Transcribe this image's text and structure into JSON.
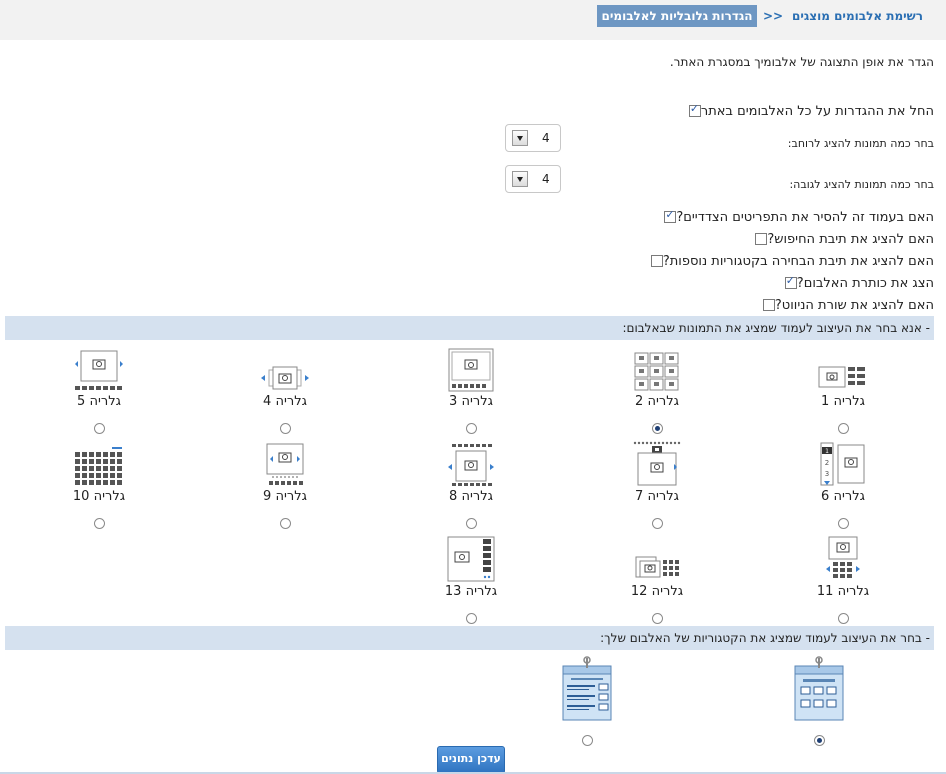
{
  "breadcrumb": {
    "active": "הגדרות גלובליות לאלבומים",
    "separator": ">>",
    "link": "רשימת אלבומים מוצגים"
  },
  "intro": "הגדר את אופן התצוגה של אלבומיך במסגרת האתר.",
  "apply_all": {
    "label": "החל את ההגדרות על כל האלבומים באתר",
    "checked": true
  },
  "width_select": {
    "label": "בחר כמה תמונות להציג לרוחב:",
    "value": "4"
  },
  "height_select": {
    "label": "בחר כמה תמונות להציג לגובה:",
    "value": "4"
  },
  "options": [
    {
      "label": "האם בעמוד זה להסיר את התפריטים הצדדיים?",
      "checked": true
    },
    {
      "label": "האם להציג את תיבת החיפוש?",
      "checked": false
    },
    {
      "label": "האם להציג את תיבת הבחירה בקטגוריות נוספות?",
      "checked": false
    },
    {
      "label": "הצג את כותרת האלבום?",
      "checked": true
    },
    {
      "label": "האם להציג את שורת הניווט?",
      "checked": false
    }
  ],
  "section_gallery": "- אנא בחר את העיצוב לעמוד שמציג את התמונות שבאלבום:",
  "galleries": [
    {
      "name": "גלריה 1",
      "icon": "gallery-list-icon"
    },
    {
      "name": "גלריה 2",
      "icon": "gallery-grid-icon"
    },
    {
      "name": "גלריה 3",
      "icon": "gallery-frame-icon"
    },
    {
      "name": "גלריה 4",
      "icon": "gallery-slider-icon"
    },
    {
      "name": "גלריה 5",
      "icon": "gallery-filmstrip-icon"
    },
    {
      "name": "גלריה 6",
      "icon": "gallery-vertical-pager-icon"
    },
    {
      "name": "גלריה 7",
      "icon": "gallery-top-strip-icon"
    },
    {
      "name": "גלריה 8",
      "icon": "gallery-arrows-strip-icon"
    },
    {
      "name": "גלריה 9",
      "icon": "gallery-dots-icon"
    },
    {
      "name": "גלריה 10",
      "icon": "gallery-tiles-icon"
    },
    {
      "name": "גלריה 11",
      "icon": "gallery-bottom-grid-icon"
    },
    {
      "name": "גלריה 12",
      "icon": "gallery-side-grid-icon"
    },
    {
      "name": "גלריה 13",
      "icon": "gallery-side-thumbs-icon"
    }
  ],
  "selected_gallery": "גלריה 2",
  "section_category": "- בחר את העיצוב לעמוד שמציג את הקטגוריות של האלבום שלך:",
  "category_icons": [
    "category-grid-icon",
    "category-list-icon"
  ],
  "save_button": "עדכן נתונים"
}
